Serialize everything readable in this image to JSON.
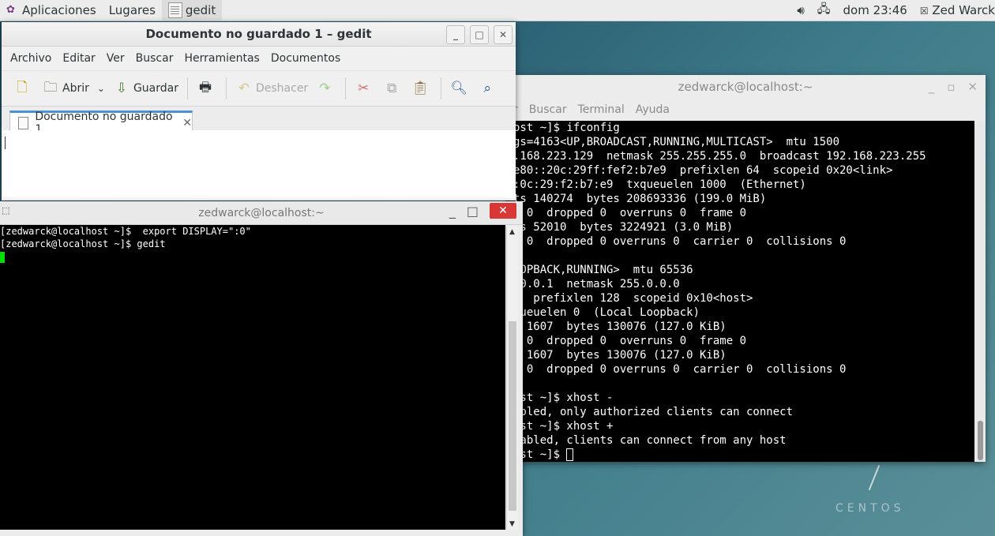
{
  "topbar": {
    "applications": "Aplicaciones",
    "places": "Lugares",
    "active_app": "gedit",
    "clock": "dom 23:46",
    "user": "Zed Warck"
  },
  "gedit": {
    "title": "Documento no guardado 1 – gedit",
    "menu": [
      "Archivo",
      "Editar",
      "Ver",
      "Buscar",
      "Herramientas",
      "Documentos"
    ],
    "toolbar": {
      "open": "Abrir",
      "save": "Guardar",
      "undo": "Deshacer"
    },
    "tab_label": "Documento no guardado 1"
  },
  "terminal_right": {
    "title": "zedwarck@localhost:~",
    "menu": [
      "r",
      "Buscar",
      "Terminal",
      "Ayuda"
    ],
    "lines": [
      "ost ~]$ ifconfig",
      "gs=4163<UP,BROADCAST,RUNNING,MULTICAST>  mtu 1500",
      ".168.223.129  netmask 255.255.255.0  broadcast 192.168.223.255",
      "e80::20c:29ff:fef2:b7e9  prefixlen 64  scopeid 0x20<link>",
      ":0c:29:f2:b7:e9  txqueuelen 1000  (Ethernet)",
      "ts 140274  bytes 208693336 (199.0 MiB)",
      "s 0  dropped 0  overruns 0  frame 0",
      "ts 52010  bytes 3224921 (3.0 MiB)",
      "s 0  dropped 0 overruns 0  carrier 0  collisions 0",
      "",
      "OOPBACK,RUNNING>  mtu 65536",
      ".0.0.1  netmask 255.0.0.0",
      "   prefixlen 128  scopeid 0x10<host>",
      "queuelen 0  (Local Loopback)",
      "s 1607  bytes 130076 (127.0 KiB)",
      "s 0  dropped 0  overruns 0  frame 0",
      "s 1607  bytes 130076 (127.0 KiB)",
      "s 0  dropped 0 overruns 0  carrier 0  collisions 0",
      "",
      "ost ~]$ xhost -",
      "abled, only authorized clients can connect",
      "ost ~]$ xhost +",
      "sabled, clients can connect from any host"
    ],
    "prompt_line": "ost ~]$ "
  },
  "terminal_left": {
    "title": "zedwarck@localhost:~",
    "lines": [
      "[zedwarck@localhost ~]$  export DISPLAY=\":0\"",
      "[zedwarck@localhost ~]$ gedit"
    ]
  },
  "desktop": {
    "logo_text": "CENTOS"
  },
  "colors": {
    "terminal_bg": "#000000",
    "close_red": "#d93636",
    "tab_accent": "#4a90d9",
    "cursor_green": "#00e000"
  }
}
